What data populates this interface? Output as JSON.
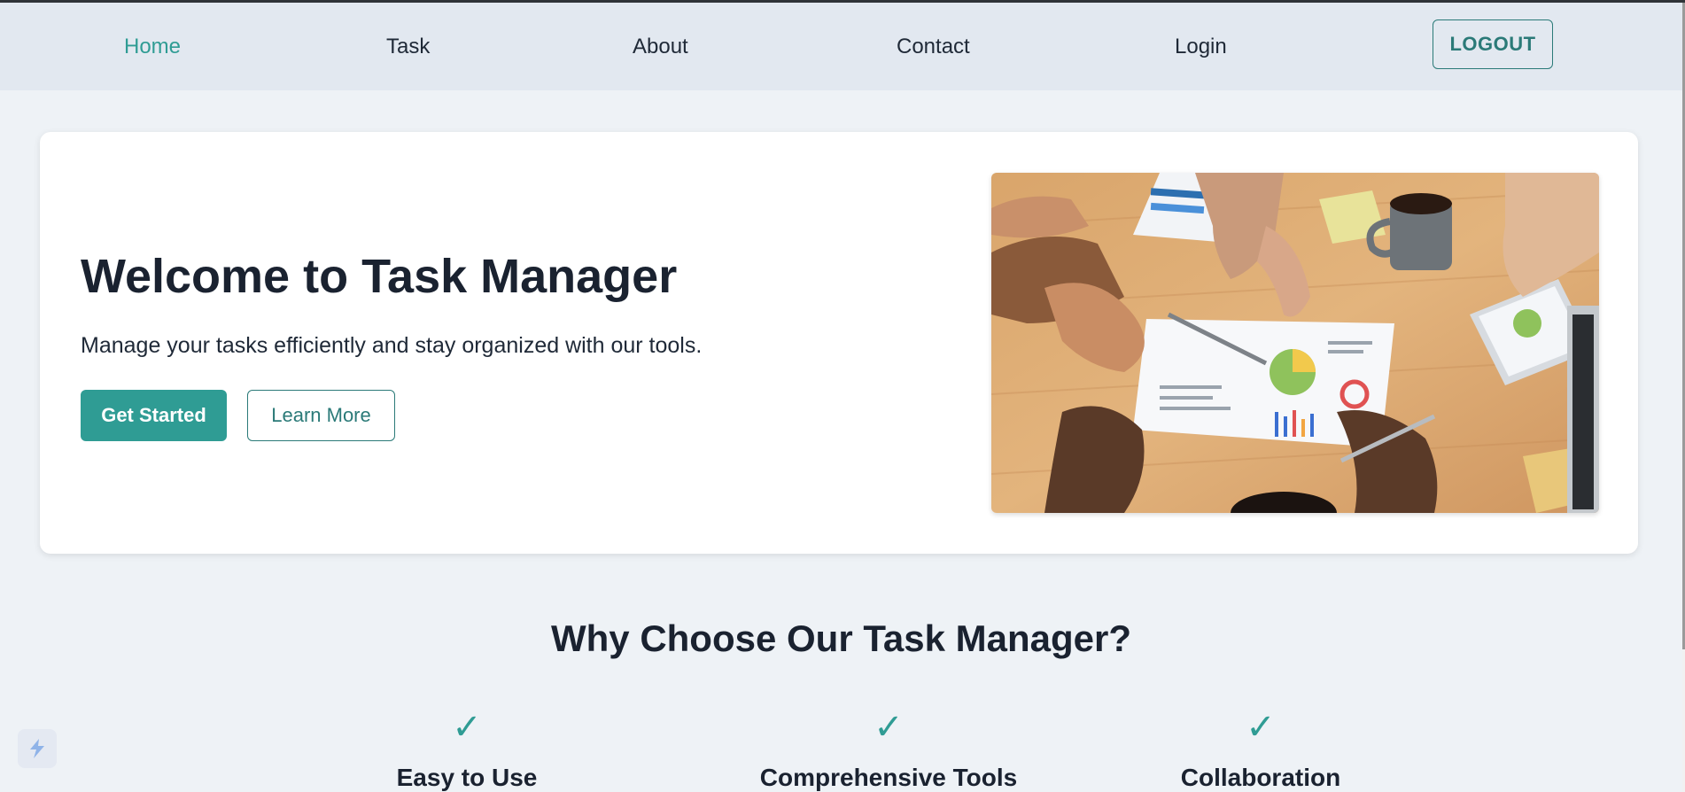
{
  "nav": {
    "items": [
      {
        "label": "Home",
        "active": true
      },
      {
        "label": "Task",
        "active": false
      },
      {
        "label": "About",
        "active": false
      },
      {
        "label": "Contact",
        "active": false
      },
      {
        "label": "Login",
        "active": false
      }
    ],
    "logout_label": "LOGOUT"
  },
  "hero": {
    "title": "Welcome to Task Manager",
    "subtitle": "Manage your tasks efficiently and stay organized with our tools.",
    "primary_button": "Get Started",
    "secondary_button": "Learn More",
    "image_icon": "team-meeting-photo"
  },
  "features": {
    "title": "Why Choose Our Task Manager?",
    "check_symbol": "✓",
    "items": [
      {
        "title": "Easy to Use",
        "icon": "check-icon"
      },
      {
        "title": "Comprehensive Tools",
        "icon": "check-icon"
      },
      {
        "title": "Collaboration",
        "icon": "check-icon"
      }
    ]
  },
  "colors": {
    "accent": "#2f9c94",
    "accent_dark": "#2b7a78",
    "nav_bg": "#e2e8f0",
    "page_bg": "#eef2f6",
    "text": "#1a2230"
  }
}
